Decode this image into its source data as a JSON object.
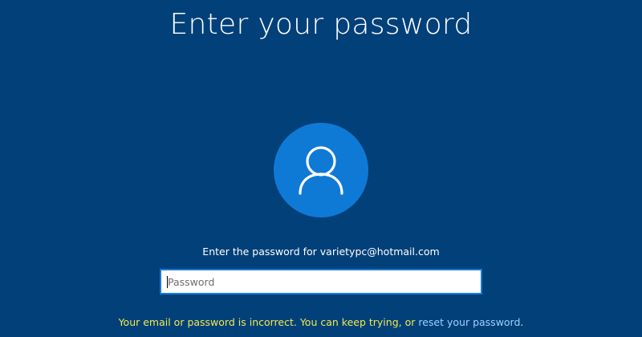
{
  "page": {
    "title": "Enter your password",
    "avatar_icon": "user-icon",
    "prompt": "Enter the password for varietypc@hotmail.com",
    "password_field": {
      "placeholder": "Password",
      "value": ""
    },
    "error": {
      "message": "Your email or password is incorrect. You can keep trying, or",
      "link_text": "reset your password",
      "suffix": "."
    }
  },
  "colors": {
    "background": "#024079",
    "avatar": "#0f79d6",
    "input_border": "#1a7ad6",
    "error_text": "#f5e84e",
    "link_text": "#9fd2ff"
  }
}
